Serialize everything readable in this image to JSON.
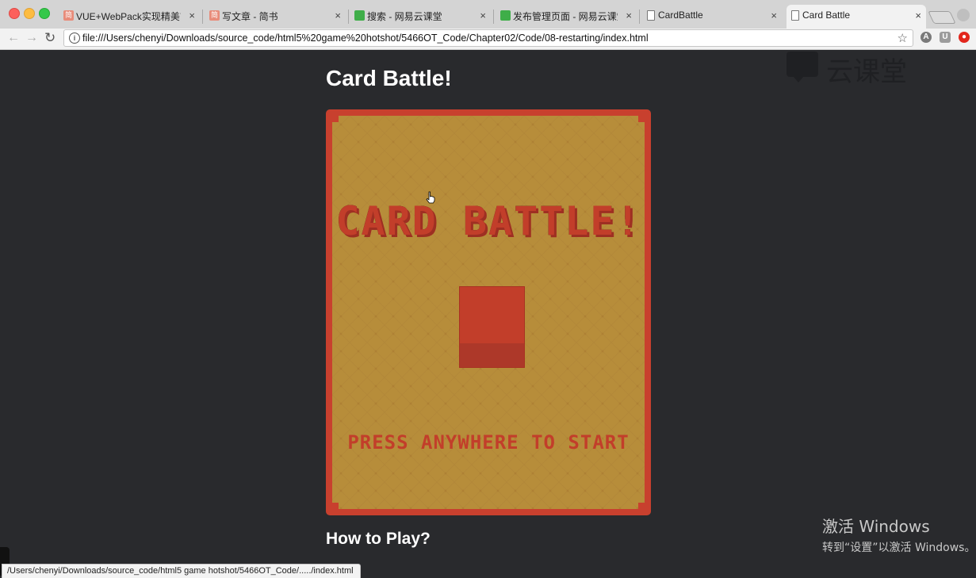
{
  "browser": {
    "tabs": [
      {
        "label": "VUE+WebPack实现精美前端",
        "favicon": "jian-icon",
        "active": false
      },
      {
        "label": "写文章 - 简书",
        "favicon": "jian-icon",
        "active": false
      },
      {
        "label": "搜索 - 网易云课堂",
        "favicon": "netease-icon",
        "active": false
      },
      {
        "label": "发布管理页面 - 网易云课堂",
        "favicon": "netease-icon",
        "active": false
      },
      {
        "label": "CardBattle",
        "favicon": "document-icon",
        "active": false
      },
      {
        "label": "Card Battle",
        "favicon": "document-icon",
        "active": true
      }
    ],
    "tab_close_glyph": "×",
    "favicon_jian_glyph": "简",
    "address": "file:///Users/chenyi/Downloads/source_code/html5%20game%20hotshot/5466OT_Code/Chapter02/Code/08-restarting/index.html",
    "extensions": [
      "A",
      "U",
      "●"
    ],
    "status_url": "/Users/chenyi/Downloads/source_code/html5 game hotshot/5466OT_Code/...../index.html"
  },
  "page": {
    "heading": "Card Battle!",
    "game": {
      "title": "CARD BATTLE!",
      "prompt": "PRESS ANYWHERE TO START"
    },
    "subheading": "How to Play?"
  },
  "overlay": {
    "watermark": "云课堂",
    "activation_title": "激活 Windows",
    "activation_hint": "转到“设置”以激活 Windows。"
  },
  "colors": {
    "page_background": "#292a2d",
    "game_frame": "#c8402e",
    "board": "#b78d3a",
    "game_text": "#c23e2a"
  }
}
